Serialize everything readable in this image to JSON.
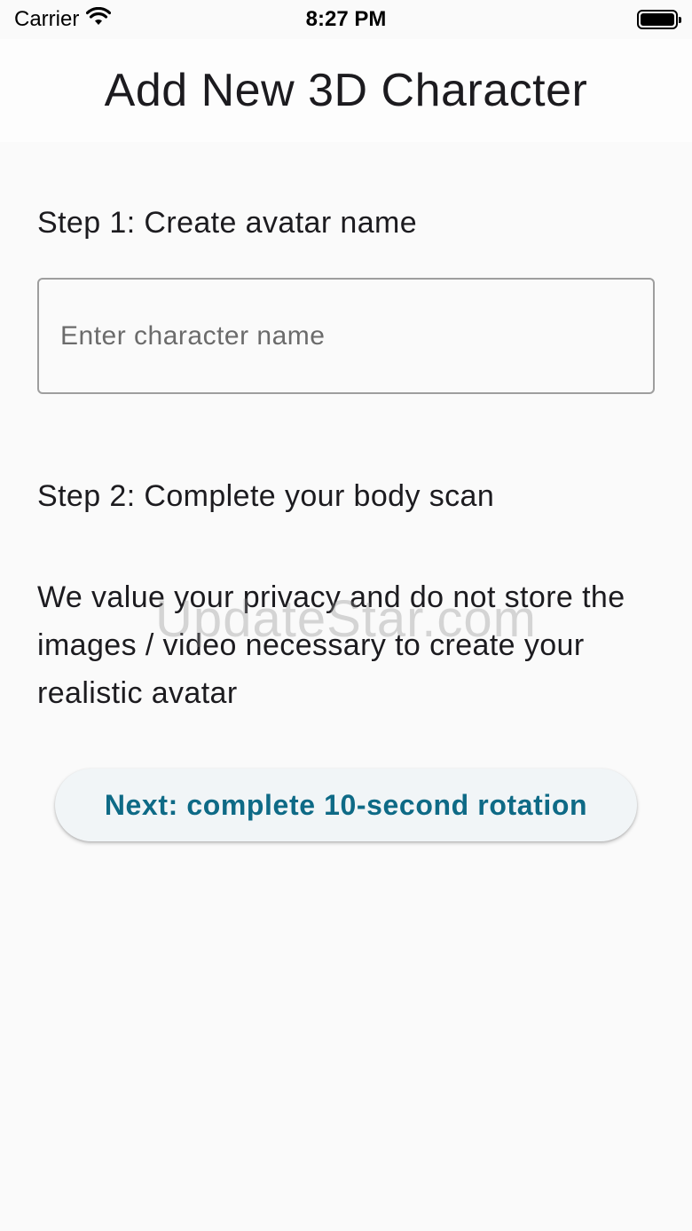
{
  "status_bar": {
    "carrier": "Carrier",
    "time": "8:27 PM",
    "wifi_icon": "wifi-icon",
    "battery_icon": "battery-icon"
  },
  "app_bar": {
    "title": "Add New 3D Character"
  },
  "step1": {
    "label": "Step 1: Create avatar name",
    "name_input": {
      "value": "",
      "placeholder": "Enter character name"
    }
  },
  "step2": {
    "label": "Step 2: Complete your body scan",
    "privacy_text": "We value your privacy and do not store the images / video necessary to create your realistic avatar"
  },
  "next_button": {
    "label": "Next: complete 10-second rotation"
  },
  "watermark": "UpdateStar.com",
  "colors": {
    "background": "#fafafa",
    "accent": "#0e6a86",
    "button_bg": "#f1f5f7",
    "text": "#1c1b1f"
  }
}
